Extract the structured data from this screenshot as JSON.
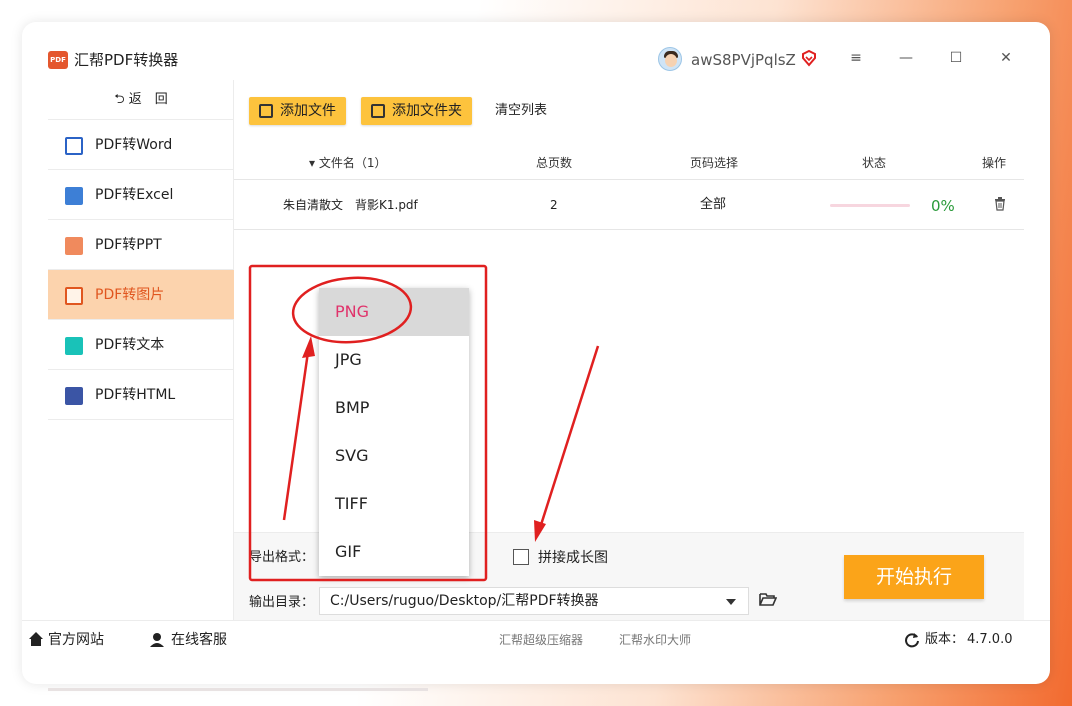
{
  "app": {
    "title": "汇帮PDF转换器",
    "logo_text": "PDF",
    "username": "awS8PVjPqlsZ"
  },
  "window_controls": {
    "menu": "≡",
    "minimize": "—",
    "maximize": "☐",
    "close": "✕"
  },
  "sidebar": {
    "back": "⮌ 返　回",
    "items": [
      {
        "label": "PDF转Word",
        "icon": "word-icon",
        "color": "#2b63c6"
      },
      {
        "label": "PDF转Excel",
        "icon": "excel-icon",
        "color": "#3d7fd6"
      },
      {
        "label": "PDF转PPT",
        "icon": "ppt-icon",
        "color": "#f08a5d"
      },
      {
        "label": "PDF转图片",
        "icon": "image-icon",
        "color": "#e0561f",
        "active": true
      },
      {
        "label": "PDF转文本",
        "icon": "text-icon",
        "color": "#19c2b8"
      },
      {
        "label": "PDF转HTML",
        "icon": "html-icon",
        "color": "#3b55a5"
      }
    ]
  },
  "toolbar": {
    "add_file": "添加文件",
    "add_folder": "添加文件夹",
    "clear_list": "清空列表"
  },
  "table": {
    "headers": {
      "filename": "▾ 文件名（1）",
      "pages": "总页数",
      "page_select": "页码选择",
      "status": "状态",
      "action": "操作"
    },
    "rows": [
      {
        "filename": "朱自清散文　背影K1.pdf",
        "pages": "2",
        "page_select": "全部",
        "progress": "0%"
      }
    ]
  },
  "options": {
    "export_format_label": "导出格式：",
    "merge_long_image_label": "拼接成长图",
    "output_dir_label": "输出目录：",
    "output_dir_value": "C:/Users/ruguo/Desktop/汇帮PDF转换器"
  },
  "format_dropdown": {
    "options": [
      "PNG",
      "JPG",
      "BMP",
      "SVG",
      "TIFF",
      "GIF"
    ],
    "selected": "PNG"
  },
  "start_button": "开始执行",
  "footer": {
    "website": "官方网站",
    "support": "在线客服",
    "tool1": "汇帮超级压缩器",
    "tool2": "汇帮水印大师",
    "version_label": "版本：",
    "version": "4.7.0.0"
  },
  "colors": {
    "accent_orange": "#fba419",
    "toolbar_yellow": "#fdc33d",
    "active_nav_bg": "#fcd3ad",
    "annotation_red": "#e02020",
    "selected_text": "#e0336b",
    "progress_green": "#2a9a3a"
  }
}
